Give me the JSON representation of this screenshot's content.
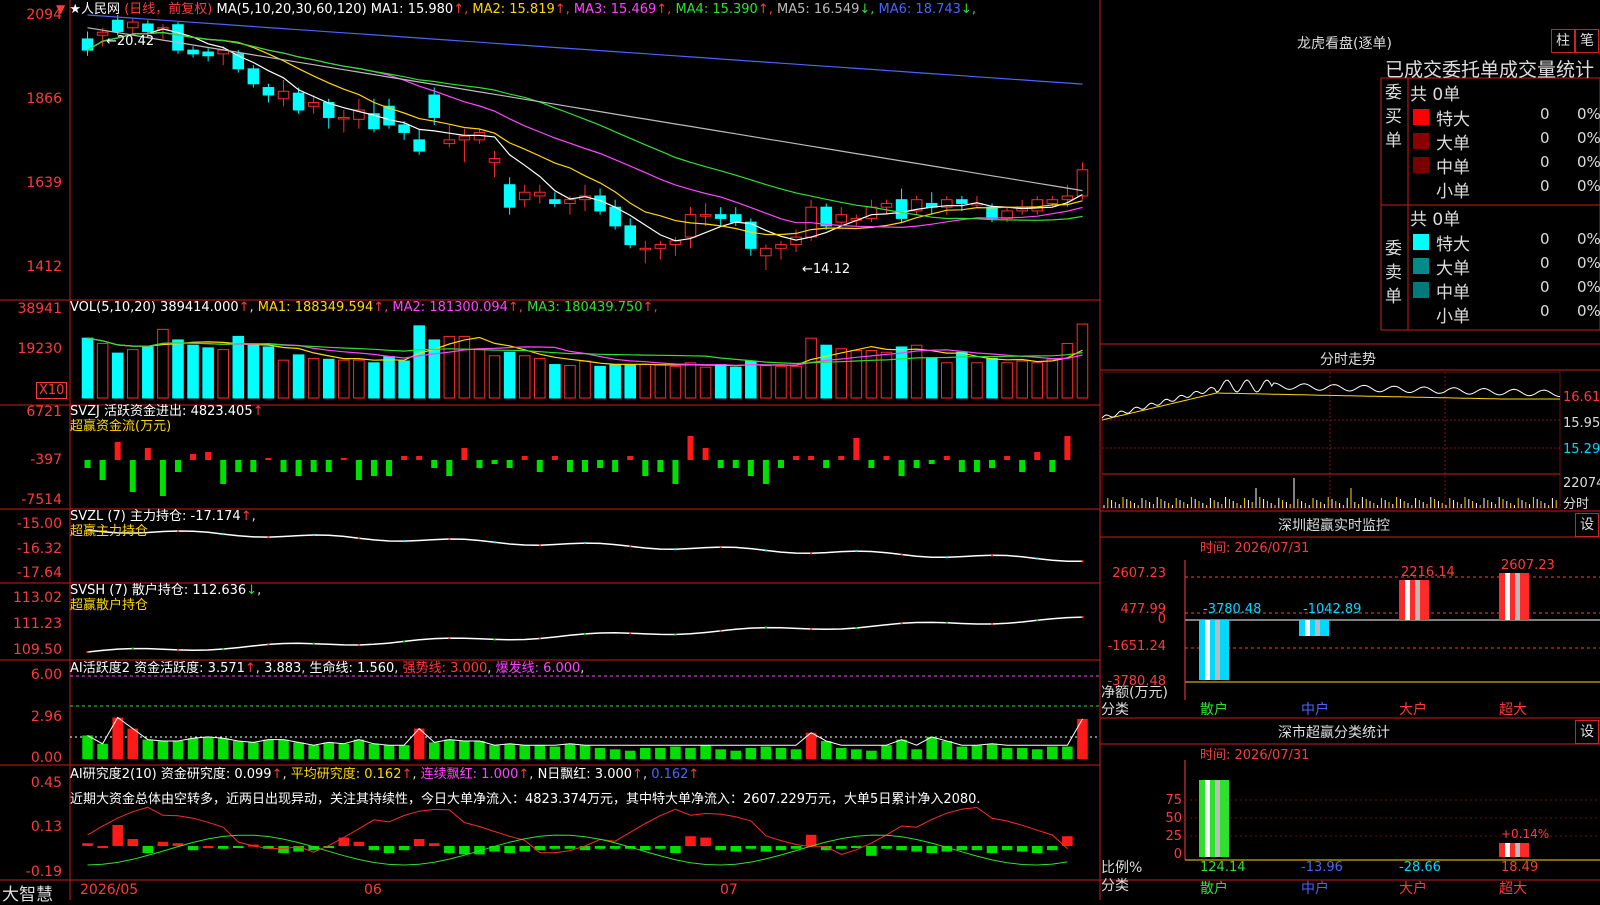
{
  "app": {
    "brand": "大智慧"
  },
  "main": {
    "stock_name": "人民网",
    "mode": "(日线，前复权)",
    "ma_label": "MA(5,10,20,30,60,120)",
    "ma_values": [
      {
        "name": "MA1",
        "value": "15.980",
        "arrow": "↑",
        "color": "#ffffff"
      },
      {
        "name": "MA2",
        "value": "15.819",
        "arrow": "↑",
        "color": "#ffd700"
      },
      {
        "name": "MA3",
        "value": "15.469",
        "arrow": "↑",
        "color": "#ff44ff"
      },
      {
        "name": "MA4",
        "value": "15.390",
        "arrow": "↑",
        "color": "#2fe02f"
      },
      {
        "name": "MA5",
        "value": "16.549",
        "arrow": "↓",
        "color": "#bbbbbb"
      },
      {
        "name": "MA6",
        "value": "18.743",
        "arrow": "↓",
        "color": "#4a64ff"
      }
    ],
    "y_ticks": [
      "2094",
      "1866",
      "1639",
      "1412"
    ],
    "high_label": "←20.42",
    "low_label": "←14.12",
    "x_labels": [
      "2026/05",
      "06",
      "07"
    ]
  },
  "vol": {
    "label": "VOL(5,10,20)",
    "value": "389414.000",
    "arrow": "↑",
    "ma": [
      {
        "name": "MA1",
        "value": "188349.594",
        "color": "#ffd700"
      },
      {
        "name": "MA2",
        "value": "181300.094",
        "color": "#ff44ff"
      },
      {
        "name": "MA3",
        "value": "180439.750",
        "color": "#2fe02f"
      }
    ],
    "y_ticks": [
      "38941",
      "19230"
    ],
    "unit": "X10"
  },
  "svzj": {
    "label": "SVZJ",
    "title": "活跃资金进出:",
    "value": "4823.405",
    "arrow": "↑",
    "subtitle": "超赢资金流(万元)",
    "y_ticks": [
      "6721",
      "-397",
      "-7514"
    ]
  },
  "svzl": {
    "label": "SVZL (7)",
    "title": "主力持仓:",
    "value": "-17.174",
    "arrow": "↑",
    "subtitle": "超赢主力持仓",
    "y_ticks": [
      "-15.00",
      "-16.32",
      "-17.64"
    ]
  },
  "svsh": {
    "label": "SVSH (7)",
    "title": "散户持仓:",
    "value": "112.636",
    "arrow": "↓",
    "subtitle": "超赢散户持仓",
    "y_ticks": [
      "113.02",
      "111.23",
      "109.50"
    ]
  },
  "ai1": {
    "label": "AI活跃度2",
    "title": "资金活跃度:",
    "v1": "3.571",
    "v2": "3.883",
    "life_label": "生命线:",
    "life": "1.560",
    "strong": "强势线: 3.000",
    "burst": "爆发线: 6.000",
    "y_ticks": [
      "6.00",
      "2.96",
      "0.00"
    ]
  },
  "ai2": {
    "label": "AI研究度2(10)",
    "title": "资金研究度:",
    "v1": "0.099",
    "avg": "平均研究度: 0.162",
    "cont": "连续飘红: 1.000",
    "nday": "N日飘红: 3.000",
    "v5": "0.162",
    "comment": "近期大资金总体由空转多，近两日出现异动，关注其持续性，今日大单净流入：4823.374万元，其中特大单净流入：2607.229万元，大单5日累计净入2080.",
    "y_ticks": [
      "0.45",
      "0.13",
      "-0.19"
    ]
  },
  "right": {
    "lhkp": {
      "title": "龙虎看盘(逐单)",
      "btn1": "柱",
      "btn2": "笔",
      "subtitle": "已成交委托单成交量统计",
      "buy_header": "委买单",
      "sell_header": "委卖单",
      "buy_total": "共 0单",
      "sell_total": "共 0单",
      "buy_rows": [
        {
          "label": "特大",
          "count": "0",
          "pct": "0%",
          "color": "#ff0000"
        },
        {
          "label": "大单",
          "count": "0",
          "pct": "0%",
          "color": "#8b0000"
        },
        {
          "label": "中单",
          "count": "0",
          "pct": "0%",
          "color": "#7a0000"
        },
        {
          "label": "小单",
          "count": "0",
          "pct": "0%",
          "color": "#000000"
        }
      ],
      "sell_rows": [
        {
          "label": "特大",
          "count": "0",
          "pct": "0%",
          "color": "#00ffff"
        },
        {
          "label": "大单",
          "count": "0",
          "pct": "0%",
          "color": "#008b8b"
        },
        {
          "label": "中单",
          "count": "0",
          "pct": "0%",
          "color": "#007a7a"
        },
        {
          "label": "小单",
          "count": "0",
          "pct": "0%",
          "color": "#000000"
        }
      ]
    },
    "fs": {
      "title": "分时走势",
      "y_ticks": [
        "16.61",
        "15.95",
        "15.29"
      ],
      "vol_tick": "22074",
      "vol_unit": "分时"
    },
    "monitor": {
      "title": "深圳超赢实时监控",
      "btn": "设",
      "time": "时间: 2026/07/31",
      "y_ticks": [
        "2607.23",
        "477.99",
        "0",
        "-1651.24",
        "-3780.48"
      ],
      "ylabel": "净额(万元)",
      "xlabel": "分类",
      "categories": [
        "散户",
        "中户",
        "大户",
        "超大"
      ],
      "values_text": [
        "-3780.48",
        "-1042.89",
        "2216.14",
        "2607.23"
      ]
    },
    "classify": {
      "title": "深市超赢分类统计",
      "btn": "设",
      "time": "时间: 2026/07/31",
      "y_ticks": [
        "75",
        "50",
        "25",
        "0"
      ],
      "ylabel": "比例%",
      "xlabel": "分类",
      "categories": [
        "散户",
        "中户",
        "大户",
        "超大"
      ],
      "values_text": [
        "124.14",
        "-13.96",
        "-28.66",
        "18.49"
      ],
      "annot": "+0.14%"
    }
  },
  "chart_data": {
    "type": "candlestick",
    "candles": [
      {
        "o": 2030,
        "h": 2050,
        "l": 1985,
        "c": 2000
      },
      {
        "o": 2040,
        "h": 2060,
        "l": 2010,
        "c": 2048
      },
      {
        "o": 2080,
        "h": 2094,
        "l": 2040,
        "c": 2050
      },
      {
        "o": 2060,
        "h": 2085,
        "l": 2040,
        "c": 2075
      },
      {
        "o": 2070,
        "h": 2080,
        "l": 2040,
        "c": 2050
      },
      {
        "o": 2060,
        "h": 2070,
        "l": 2030,
        "c": 2060
      },
      {
        "o": 2068,
        "h": 2075,
        "l": 1990,
        "c": 2000
      },
      {
        "o": 2000,
        "h": 2010,
        "l": 1980,
        "c": 1990
      },
      {
        "o": 1995,
        "h": 2005,
        "l": 1970,
        "c": 1985
      },
      {
        "o": 1990,
        "h": 2010,
        "l": 1960,
        "c": 2000
      },
      {
        "o": 1990,
        "h": 2000,
        "l": 1940,
        "c": 1950
      },
      {
        "o": 1950,
        "h": 1960,
        "l": 1900,
        "c": 1910
      },
      {
        "o": 1900,
        "h": 1910,
        "l": 1860,
        "c": 1880
      },
      {
        "o": 1870,
        "h": 1920,
        "l": 1850,
        "c": 1890
      },
      {
        "o": 1885,
        "h": 1900,
        "l": 1830,
        "c": 1840
      },
      {
        "o": 1850,
        "h": 1880,
        "l": 1830,
        "c": 1860
      },
      {
        "o": 1860,
        "h": 1870,
        "l": 1790,
        "c": 1820
      },
      {
        "o": 1820,
        "h": 1840,
        "l": 1780,
        "c": 1820
      },
      {
        "o": 1815,
        "h": 1870,
        "l": 1790,
        "c": 1840
      },
      {
        "o": 1830,
        "h": 1870,
        "l": 1780,
        "c": 1790
      },
      {
        "o": 1850,
        "h": 1870,
        "l": 1790,
        "c": 1800
      },
      {
        "o": 1800,
        "h": 1810,
        "l": 1760,
        "c": 1780
      },
      {
        "o": 1760,
        "h": 1790,
        "l": 1720,
        "c": 1730
      },
      {
        "o": 1880,
        "h": 1900,
        "l": 1800,
        "c": 1820
      },
      {
        "o": 1750,
        "h": 1800,
        "l": 1740,
        "c": 1760
      },
      {
        "o": 1760,
        "h": 1790,
        "l": 1700,
        "c": 1770
      },
      {
        "o": 1760,
        "h": 1790,
        "l": 1750,
        "c": 1780
      },
      {
        "o": 1700,
        "h": 1730,
        "l": 1660,
        "c": 1710
      },
      {
        "o": 1640,
        "h": 1660,
        "l": 1560,
        "c": 1580
      },
      {
        "o": 1600,
        "h": 1640,
        "l": 1580,
        "c": 1620
      },
      {
        "o": 1610,
        "h": 1640,
        "l": 1590,
        "c": 1620
      },
      {
        "o": 1600,
        "h": 1620,
        "l": 1580,
        "c": 1590
      },
      {
        "o": 1590,
        "h": 1610,
        "l": 1560,
        "c": 1600
      },
      {
        "o": 1600,
        "h": 1640,
        "l": 1570,
        "c": 1610
      },
      {
        "o": 1610,
        "h": 1630,
        "l": 1560,
        "c": 1570
      },
      {
        "o": 1580,
        "h": 1600,
        "l": 1520,
        "c": 1530
      },
      {
        "o": 1530,
        "h": 1550,
        "l": 1470,
        "c": 1480
      },
      {
        "o": 1470,
        "h": 1490,
        "l": 1430,
        "c": 1470
      },
      {
        "o": 1470,
        "h": 1490,
        "l": 1440,
        "c": 1480
      },
      {
        "o": 1480,
        "h": 1500,
        "l": 1450,
        "c": 1490
      },
      {
        "o": 1500,
        "h": 1580,
        "l": 1470,
        "c": 1560
      },
      {
        "o": 1560,
        "h": 1590,
        "l": 1530,
        "c": 1560
      },
      {
        "o": 1560,
        "h": 1580,
        "l": 1530,
        "c": 1550
      },
      {
        "o": 1560,
        "h": 1580,
        "l": 1530,
        "c": 1540
      },
      {
        "o": 1540,
        "h": 1550,
        "l": 1450,
        "c": 1470
      },
      {
        "o": 1450,
        "h": 1480,
        "l": 1412,
        "c": 1470
      },
      {
        "o": 1470,
        "h": 1490,
        "l": 1440,
        "c": 1480
      },
      {
        "o": 1480,
        "h": 1520,
        "l": 1460,
        "c": 1500
      },
      {
        "o": 1500,
        "h": 1600,
        "l": 1490,
        "c": 1580
      },
      {
        "o": 1580,
        "h": 1590,
        "l": 1520,
        "c": 1530
      },
      {
        "o": 1540,
        "h": 1580,
        "l": 1530,
        "c": 1560
      },
      {
        "o": 1545,
        "h": 1560,
        "l": 1530,
        "c": 1550
      },
      {
        "o": 1550,
        "h": 1600,
        "l": 1540,
        "c": 1580
      },
      {
        "o": 1580,
        "h": 1600,
        "l": 1560,
        "c": 1590
      },
      {
        "o": 1600,
        "h": 1630,
        "l": 1540,
        "c": 1550
      },
      {
        "o": 1570,
        "h": 1610,
        "l": 1560,
        "c": 1600
      },
      {
        "o": 1590,
        "h": 1620,
        "l": 1560,
        "c": 1580
      },
      {
        "o": 1580,
        "h": 1610,
        "l": 1560,
        "c": 1600
      },
      {
        "o": 1600,
        "h": 1610,
        "l": 1570,
        "c": 1590
      },
      {
        "o": 1590,
        "h": 1610,
        "l": 1580,
        "c": 1590
      },
      {
        "o": 1580,
        "h": 1590,
        "l": 1540,
        "c": 1550
      },
      {
        "o": 1550,
        "h": 1580,
        "l": 1540,
        "c": 1570
      },
      {
        "o": 1570,
        "h": 1600,
        "l": 1560,
        "c": 1580
      },
      {
        "o": 1570,
        "h": 1610,
        "l": 1560,
        "c": 1600
      },
      {
        "o": 1590,
        "h": 1610,
        "l": 1580,
        "c": 1600
      },
      {
        "o": 1600,
        "h": 1640,
        "l": 1580,
        "c": 1610
      },
      {
        "o": 1610,
        "h": 1700,
        "l": 1600,
        "c": 1680
      }
    ],
    "volume": [
      0.68,
      0.62,
      0.51,
      0.55,
      0.58,
      0.78,
      0.66,
      0.6,
      0.57,
      0.55,
      0.7,
      0.61,
      0.58,
      0.43,
      0.49,
      0.45,
      0.44,
      0.43,
      0.43,
      0.4,
      0.47,
      0.42,
      0.82,
      0.66,
      0.7,
      0.7,
      0.56,
      0.48,
      0.52,
      0.48,
      0.45,
      0.38,
      0.37,
      0.42,
      0.36,
      0.38,
      0.38,
      0.38,
      0.38,
      0.36,
      0.4,
      0.35,
      0.38,
      0.35,
      0.42,
      0.37,
      0.36,
      0.36,
      0.68,
      0.6,
      0.56,
      0.54,
      0.54,
      0.52,
      0.58,
      0.6,
      0.45,
      0.4,
      0.52,
      0.4,
      0.45,
      0.4,
      0.42,
      0.4,
      0.44,
      0.62,
      0.84
    ],
    "svzj": [
      -0.2,
      -0.5,
      0.45,
      -0.8,
      0.3,
      -0.9,
      -0.3,
      0.15,
      0.2,
      -0.6,
      -0.3,
      -0.3,
      0.05,
      -0.3,
      -0.4,
      -0.3,
      -0.3,
      0.05,
      -0.5,
      -0.4,
      -0.4,
      0.1,
      0.1,
      -0.2,
      -0.4,
      0.3,
      -0.2,
      -0.1,
      -0.2,
      0.1,
      -0.3,
      0.1,
      -0.3,
      -0.3,
      -0.2,
      -0.3,
      0.1,
      -0.4,
      -0.3,
      -0.6,
      0.6,
      0.3,
      -0.2,
      -0.2,
      -0.4,
      -0.6,
      -0.2,
      0.1,
      0.1,
      -0.2,
      0.1,
      0.55,
      -0.2,
      0.1,
      -0.4,
      -0.2,
      -0.1,
      0.1,
      -0.3,
      -0.3,
      -0.2,
      0.1,
      -0.3,
      0.2,
      -0.3,
      0.6
    ],
    "ai1": [
      1.7,
      1.1,
      3.0,
      2.2,
      1.4,
      1.3,
      1.3,
      1.5,
      1.6,
      1.5,
      1.3,
      1.2,
      1.4,
      1.4,
      1.2,
      1.0,
      1.2,
      1.1,
      1.4,
      1.1,
      1.0,
      1.0,
      2.2,
      1.2,
      1.4,
      1.3,
      1.3,
      1.0,
      1.1,
      1.0,
      1.0,
      0.9,
      1.1,
      1.0,
      0.8,
      0.7,
      0.6,
      0.8,
      0.8,
      0.9,
      0.8,
      1.0,
      0.7,
      0.6,
      0.8,
      0.9,
      0.8,
      0.7,
      1.9,
      1.3,
      0.8,
      0.7,
      0.6,
      1.0,
      1.4,
      0.7,
      1.6,
      1.3,
      0.9,
      1.0,
      1.1,
      0.8,
      0.8,
      0.7,
      0.9,
      0.9,
      2.9
    ],
    "ai2": [
      0.02,
      0.0,
      0.15,
      0.05,
      -0.05,
      0.03,
      0.02,
      -0.03,
      0.0,
      -0.02,
      -0.01,
      0.01,
      -0.02,
      -0.05,
      -0.04,
      -0.03,
      -0.01,
      0.06,
      0.03,
      -0.03,
      -0.05,
      -0.03,
      0.05,
      0.02,
      -0.05,
      -0.06,
      -0.06,
      -0.04,
      -0.05,
      -0.04,
      -0.03,
      -0.02,
      -0.02,
      -0.03,
      -0.02,
      -0.02,
      -0.02,
      -0.03,
      -0.02,
      -0.05,
      0.07,
      0.06,
      -0.03,
      -0.04,
      -0.02,
      -0.04,
      -0.03,
      -0.02,
      0.08,
      -0.03,
      -0.02,
      -0.01,
      -0.07,
      -0.02,
      -0.03,
      -0.04,
      -0.05,
      -0.04,
      -0.03,
      -0.03,
      -0.05,
      -0.03,
      -0.04,
      -0.05,
      -0.03,
      0.07
    ]
  }
}
